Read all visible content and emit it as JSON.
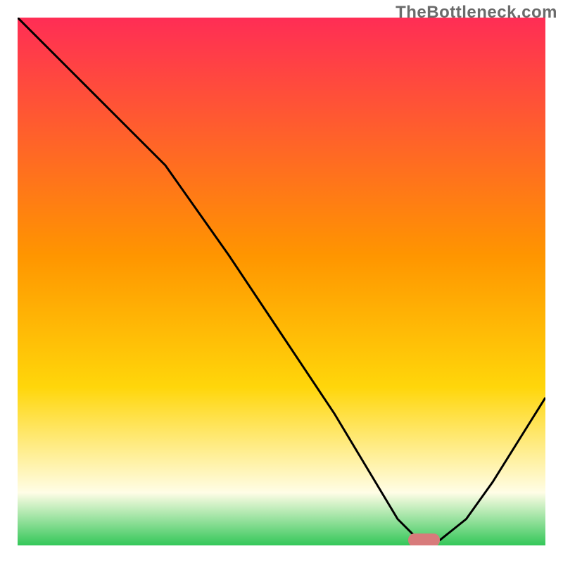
{
  "watermark": "TheBottleneck.com",
  "colors": {
    "gradient_top": "#ff2d55",
    "gradient_mid1": "#ff9500",
    "gradient_mid2": "#ffd60a",
    "gradient_low": "#fffde6",
    "gradient_bottom": "#34c759",
    "curve": "#000000",
    "marker_fill": "#d87b7b",
    "axis": "#000000"
  },
  "chart_data": {
    "type": "line",
    "title": "",
    "xlabel": "",
    "ylabel": "",
    "xlim": [
      0,
      100
    ],
    "ylim": [
      0,
      100
    ],
    "series": [
      {
        "name": "bottleneck-curve",
        "x": [
          0,
          10,
          22,
          28,
          40,
          50,
          60,
          66,
          72,
          76,
          80,
          85,
          90,
          95,
          100
        ],
        "values": [
          100,
          90,
          78,
          72,
          55,
          40,
          25,
          15,
          5,
          1,
          1,
          5,
          12,
          20,
          28
        ]
      }
    ],
    "marker": {
      "x": 77,
      "y": 1,
      "width": 6,
      "height": 2.5
    },
    "annotations": []
  }
}
